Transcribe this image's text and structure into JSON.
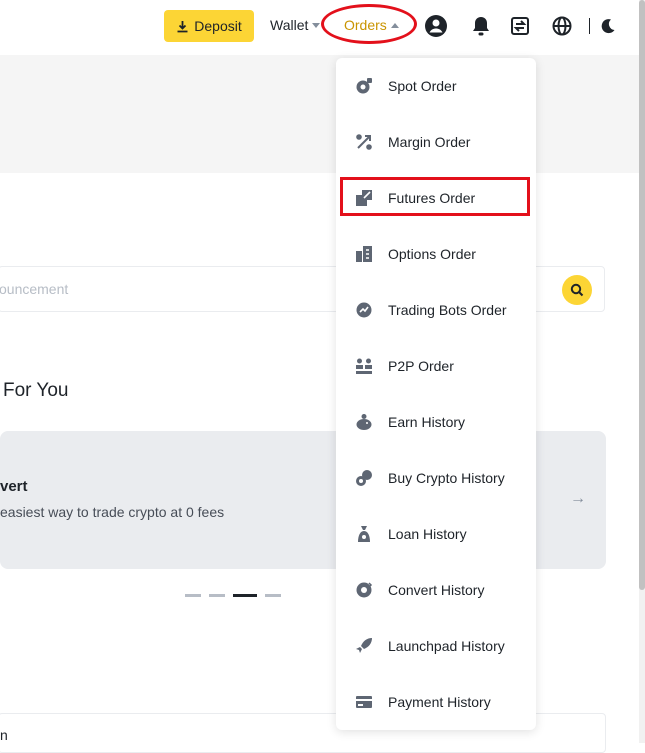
{
  "header": {
    "deposit_label": "Deposit",
    "wallet_label": "Wallet",
    "orders_label": "Orders",
    "icons": [
      "download-icon",
      "profile-icon",
      "bell-icon",
      "transfer-icon",
      "globe-icon",
      "moon-icon"
    ]
  },
  "search": {
    "placeholder_fragment": "ouncement"
  },
  "section": {
    "title": "For You"
  },
  "promo": {
    "title": "vert",
    "subtitle": "easiest way to trade crypto at 0 fees",
    "arrow": "→"
  },
  "bottom": {
    "text": "n"
  },
  "dropdown": {
    "items": [
      {
        "label": "Spot Order",
        "icon": "spot-order-icon"
      },
      {
        "label": "Margin Order",
        "icon": "margin-order-icon"
      },
      {
        "label": "Futures Order",
        "icon": "futures-order-icon"
      },
      {
        "label": "Options Order",
        "icon": "options-order-icon"
      },
      {
        "label": "Trading Bots Order",
        "icon": "trading-bots-icon"
      },
      {
        "label": "P2P Order",
        "icon": "p2p-order-icon"
      },
      {
        "label": "Earn History",
        "icon": "earn-history-icon"
      },
      {
        "label": "Buy Crypto History",
        "icon": "buy-crypto-icon"
      },
      {
        "label": "Loan History",
        "icon": "loan-history-icon"
      },
      {
        "label": "Convert History",
        "icon": "convert-history-icon"
      },
      {
        "label": "Launchpad History",
        "icon": "launchpad-history-icon"
      },
      {
        "label": "Payment History",
        "icon": "payment-history-icon"
      }
    ]
  },
  "colors": {
    "brand_yellow": "#fcd535",
    "active_orders": "#c99400",
    "annotation_red": "#e3101b",
    "text_primary": "#1e2329",
    "icon_gray": "#5e6673"
  }
}
